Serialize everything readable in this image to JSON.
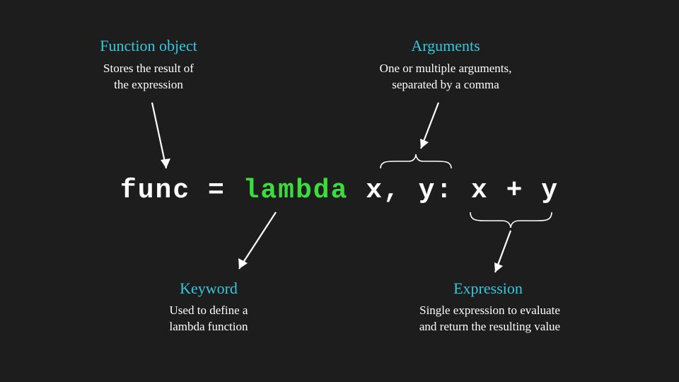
{
  "code": {
    "func": "func",
    "equals": " = ",
    "lambda": "lambda",
    "space": " ",
    "args": "x, y",
    "colon": ": ",
    "expr": "x + y"
  },
  "annotations": {
    "function_object": {
      "title": "Function object",
      "desc": "Stores the result of\nthe expression"
    },
    "arguments": {
      "title": "Arguments",
      "desc": "One or multiple arguments,\nseparated by a comma"
    },
    "keyword": {
      "title": "Keyword",
      "desc": "Used to define a\nlambda function"
    },
    "expression": {
      "title": "Expression",
      "desc": "Single expression to evaluate\nand return the resulting value"
    }
  }
}
